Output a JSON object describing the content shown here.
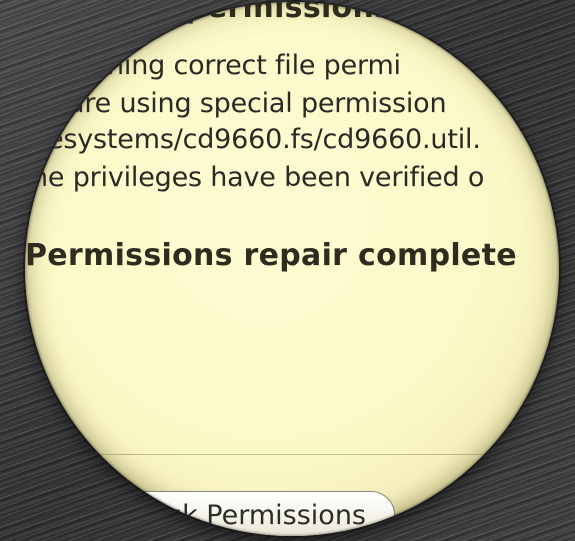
{
  "log": {
    "lines": [
      "permissions",
      "ning correct file permi",
      "are using special permission",
      "esystems/cd9660.fs/cd9660.util.",
      "he privileges have been verified o"
    ],
    "completion_heading": "Permissions repair complete"
  },
  "actions": {
    "repair_button_label": "isk Permissions"
  },
  "colors": {
    "log_background": "#fbf8c8",
    "text": "#2a2a24",
    "surround": "#3a3a3c"
  }
}
